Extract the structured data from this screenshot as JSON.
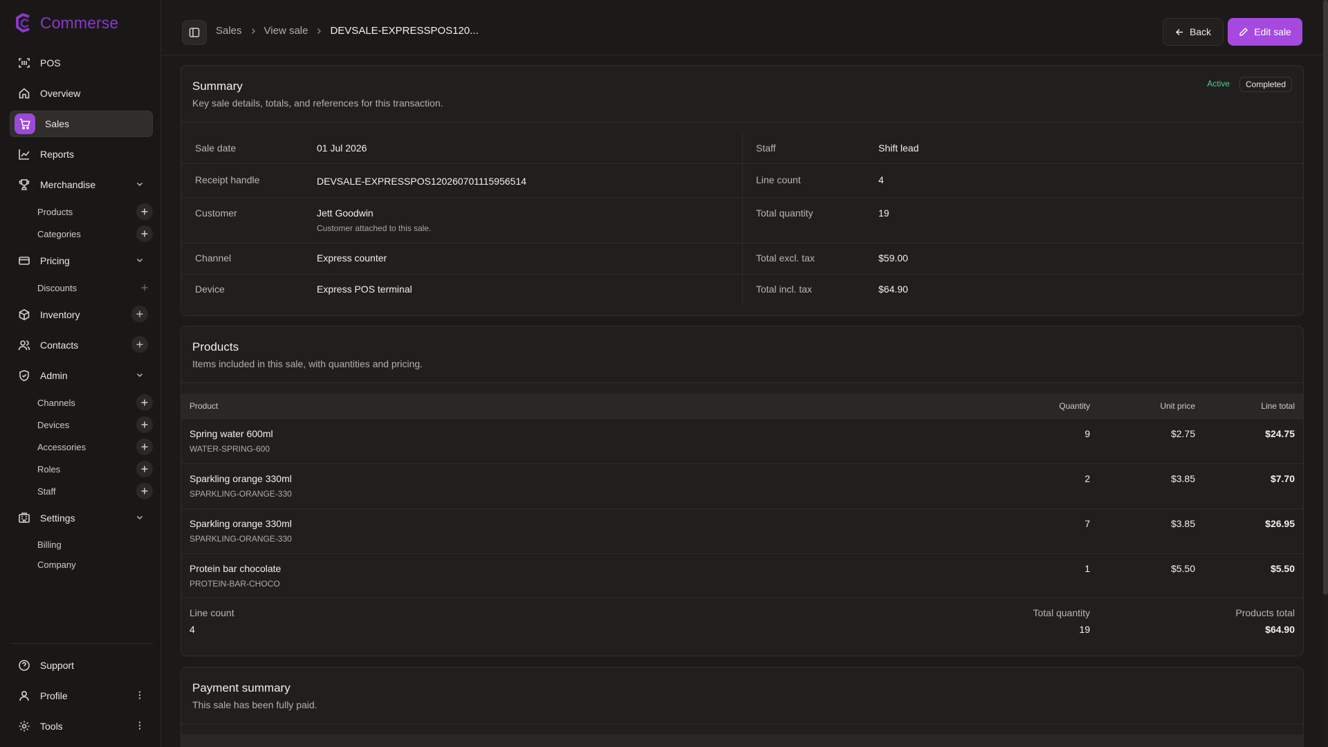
{
  "app": {
    "name": "Commerse",
    "brand_color": "#8b38c9",
    "accent": "#a549df"
  },
  "sidebar": {
    "items": {
      "pos": "POS",
      "overview": "Overview",
      "sales": "Sales",
      "reports": "Reports",
      "merchandise": "Merchandise",
      "pricing": "Pricing",
      "inventory": "Inventory",
      "contacts": "Contacts",
      "admin": "Admin",
      "settings": "Settings"
    },
    "subitems": {
      "products": "Products",
      "categories": "Categories",
      "discounts": "Discounts",
      "channels": "Channels",
      "devices": "Devices",
      "accessories": "Accessories",
      "roles": "Roles",
      "staff": "Staff",
      "billing": "Billing",
      "company": "Company"
    },
    "footer": {
      "support": "Support",
      "profile": "Profile",
      "tools": "Tools"
    }
  },
  "header": {
    "breadcrumb": [
      "Sales",
      "View sale",
      "DEVSALE-EXPRESSPOS120..."
    ],
    "back_label": "Back",
    "edit_label": "Edit sale"
  },
  "summary": {
    "title": "Summary",
    "subtitle": "Key sale details, totals, and references for this transaction.",
    "badge_active": "Active",
    "badge_completed": "Completed",
    "left": [
      {
        "label": "Sale date",
        "value": "01 Jul 2026"
      },
      {
        "label": "Receipt handle",
        "value": "DEVSALE-EXPRESSPOS120260701115956514"
      },
      {
        "label": "Customer",
        "value": "Jett Goodwin",
        "note": "Customer attached to this sale."
      },
      {
        "label": "Channel",
        "value": "Express counter"
      },
      {
        "label": "Device",
        "value": "Express POS terminal"
      }
    ],
    "right": [
      {
        "label": "Staff",
        "value": "Shift lead"
      },
      {
        "label": "Line count",
        "value": "4"
      },
      {
        "label": "Total quantity",
        "value": "19"
      },
      {
        "label": "Total excl. tax",
        "value": "$59.00"
      },
      {
        "label": "Total incl. tax",
        "value": "$64.90"
      }
    ]
  },
  "products": {
    "title": "Products",
    "subtitle": "Items included in this sale, with quantities and pricing.",
    "columns": {
      "product": "Product",
      "quantity": "Quantity",
      "unit_price": "Unit price",
      "line_total": "Line total"
    },
    "rows": [
      {
        "name": "Spring water 600ml",
        "sku": "WATER-SPRING-600",
        "qty": "9",
        "unit": "$2.75",
        "total": "$24.75"
      },
      {
        "name": "Sparkling orange 330ml",
        "sku": "SPARKLING-ORANGE-330",
        "qty": "2",
        "unit": "$3.85",
        "total": "$7.70"
      },
      {
        "name": "Sparkling orange 330ml",
        "sku": "SPARKLING-ORANGE-330",
        "qty": "7",
        "unit": "$3.85",
        "total": "$26.95"
      },
      {
        "name": "Protein bar chocolate",
        "sku": "PROTEIN-BAR-CHOCO",
        "qty": "1",
        "unit": "$5.50",
        "total": "$5.50"
      }
    ],
    "footer": {
      "line_count_label": "Line count",
      "line_count": "4",
      "total_qty_label": "Total quantity",
      "total_qty": "19",
      "products_total_label": "Products total",
      "products_total": "$64.90"
    }
  },
  "payment": {
    "title": "Payment summary",
    "subtitle": "This sale has been fully paid."
  }
}
